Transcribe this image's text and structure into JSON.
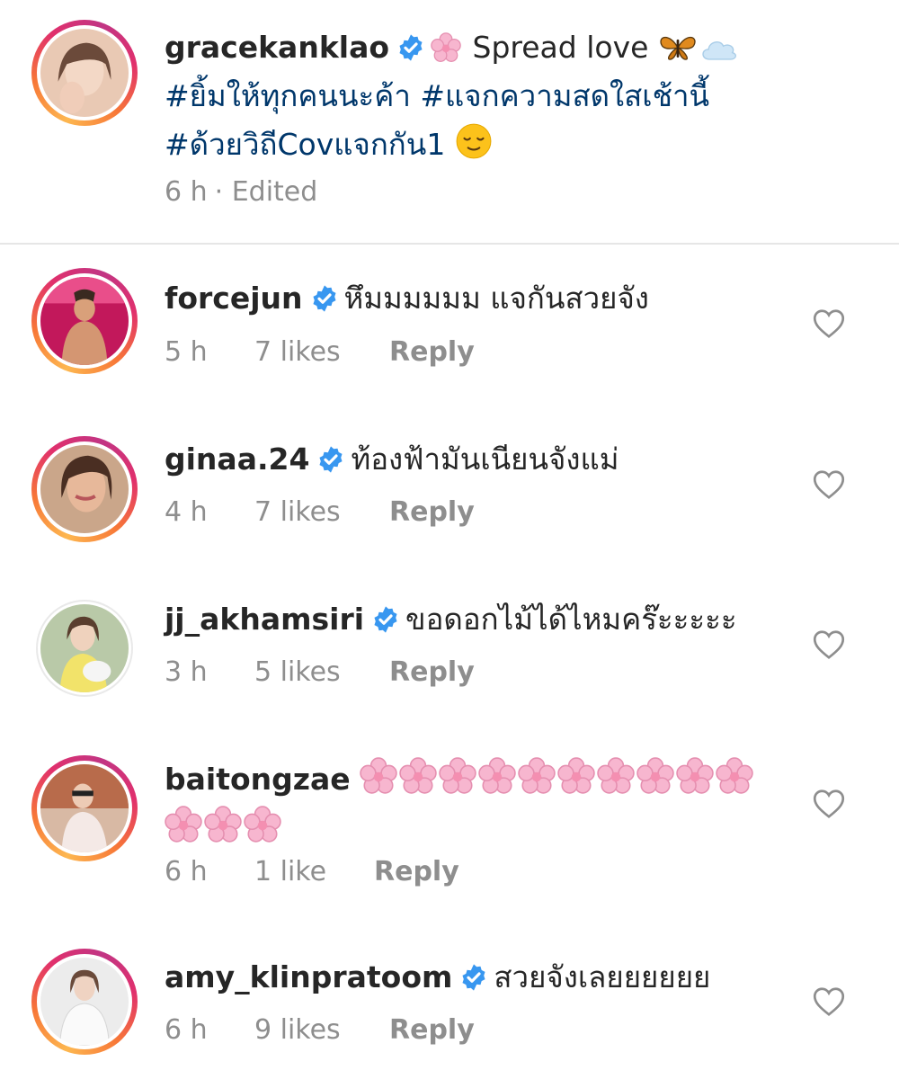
{
  "post": {
    "username": "gracekanklao",
    "caption": "Spread love",
    "hashtags_line1": "#ยิ้มให้ทุกคนนะค้า #แจกความสดใสเช้านี้",
    "hashtags_line2": "#ด้วยวิถีCovแจกกัน1",
    "time": "6 h",
    "edited": "· Edited",
    "icons": [
      "verified-badge-icon",
      "cherry-blossom-icon",
      "butterfly-icon",
      "cloud-icon",
      "relieved-face-icon"
    ]
  },
  "comments": [
    {
      "username": "forcejun",
      "text": "หึมมมมมม แจกันสวยจัง",
      "time": "5 h",
      "likes": "7 likes",
      "reply": "Reply"
    },
    {
      "username": "ginaa.24",
      "text": "ท้องฟ้ามันเนียนจังแม่",
      "time": "4 h",
      "likes": "7 likes",
      "reply": "Reply"
    },
    {
      "username": "jj_akhamsiri",
      "text": "ขอดอกไม้ได้ไหมคร๊ะะะะะ",
      "time": "3 h",
      "likes": "5 likes",
      "reply": "Reply"
    },
    {
      "username": "baitongzae",
      "text": "",
      "flower_count_line1": 10,
      "flower_count_line2": 3,
      "time": "6 h",
      "likes": "1 like",
      "reply": "Reply"
    },
    {
      "username": "amy_klinpratoom",
      "text": "สวยจังเลยยยยยย",
      "time": "6 h",
      "likes": "9 likes",
      "reply": "Reply"
    }
  ],
  "colors": {
    "text": "#262626",
    "hashtag": "#00376b",
    "meta": "#8e8e8e",
    "verified": "#3897f0",
    "divider": "#e6e6e6"
  }
}
